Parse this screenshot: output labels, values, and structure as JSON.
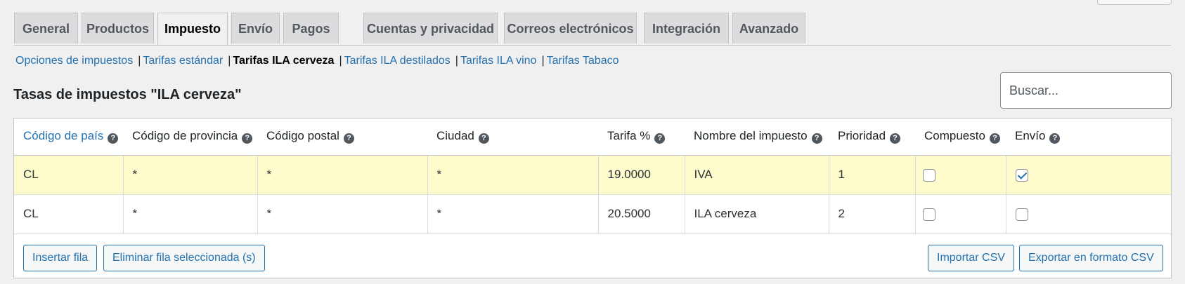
{
  "tabs": [
    {
      "label": "General"
    },
    {
      "label": "Productos"
    },
    {
      "label": "Impuesto"
    },
    {
      "label": "Envío"
    },
    {
      "label": "Pagos"
    },
    {
      "label": "Cuentas y privacidad"
    },
    {
      "label": "Correos electrónicos"
    },
    {
      "label": "Integración"
    },
    {
      "label": "Avanzado"
    }
  ],
  "active_tab": "Impuesto",
  "subnav": [
    {
      "label": "Opciones de impuestos"
    },
    {
      "label": "Tarifas estándar"
    },
    {
      "label": "Tarifas ILA cerveza"
    },
    {
      "label": "Tarifas ILA destilados"
    },
    {
      "label": "Tarifas ILA vino"
    },
    {
      "label": "Tarifas Tabaco"
    }
  ],
  "current_subnav": "Tarifas ILA cerveza",
  "separator": "|",
  "title": "Tasas de impuestos \"ILA cerveza\"",
  "search": {
    "placeholder": "Buscar..."
  },
  "table": {
    "headers": [
      {
        "label": "Código de país",
        "help": "?"
      },
      {
        "label": "Código de provincia",
        "help": "?"
      },
      {
        "label": "Código postal",
        "help": "?"
      },
      {
        "label": "Ciudad",
        "help": "?"
      },
      {
        "label": "Tarifa %",
        "help": "?"
      },
      {
        "label": "Nombre del impuesto",
        "help": "?"
      },
      {
        "label": "Prioridad",
        "help": "?"
      },
      {
        "label": "Compuesto",
        "help": "?"
      },
      {
        "label": "Envío",
        "help": "?"
      }
    ],
    "rows": [
      {
        "country": "CL",
        "state": "*",
        "postcode": "*",
        "city": "*",
        "rate": "19.0000",
        "name": "IVA",
        "priority": "1",
        "compound": false,
        "shipping": true,
        "selected": true
      },
      {
        "country": "CL",
        "state": "*",
        "postcode": "*",
        "city": "*",
        "rate": "20.5000",
        "name": "ILA cerveza",
        "priority": "2",
        "compound": false,
        "shipping": false,
        "selected": false
      }
    ]
  },
  "buttons": {
    "insert": "Insertar fila",
    "remove": "Eliminar fila seleccionada (s)",
    "import": "Importar CSV",
    "export": "Exportar en formato CSV"
  },
  "colors": {
    "link": "#2271b1",
    "selected_row": "#fefbcc",
    "background": "#f0f0f1"
  }
}
